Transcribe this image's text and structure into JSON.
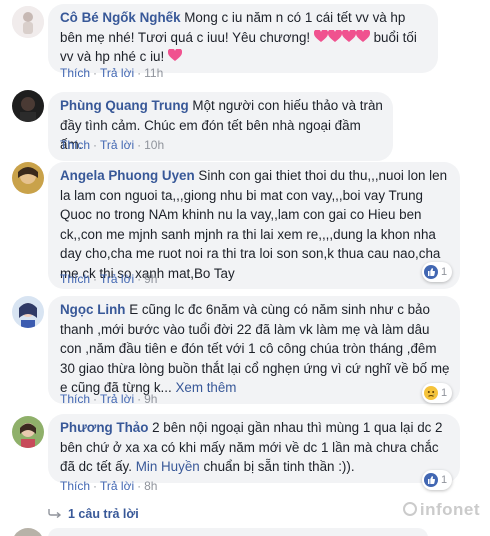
{
  "comments": [
    {
      "author": "Cô Bé Ngốk Nghếk",
      "text_1": "Mong c iu năm n có 1 cái tết vv và hp bên mẹ nhé! Tươi quá c iuu! Yêu chương!",
      "text_2": "buổi tối vv và hp nhé c iu!",
      "like": "Thích",
      "reply": "Trả lời",
      "time": "11h"
    },
    {
      "author": "Phùng Quang Trung",
      "text": "Một người con hiếu thảo và tràn đầy tình cảm. Chúc em đón tết bên nhà ngoại đầm ấm.",
      "like": "Thích",
      "reply": "Trả lời",
      "time": "10h"
    },
    {
      "author": "Angela Phuong Uyen",
      "text": "Sinh con gai thiet thoi du thu,,,nuoi lon len la lam con nguoi ta,,,giong nhu bi mat con vay,,,boi vay Trung Quoc no trong NAm khinh nu la vay,,lam con gai co Hieu ben ck,,con me mjnh sanh mjnh ra thi lai xem re,,,,dung la khon nha day cho,cha me ruot noi ra thi tra loi son son,k thua cau nao,cha me ck thi so xanh mat,Bo Tay",
      "like": "Thích",
      "reply": "Trả lời",
      "time": "9h",
      "reaction_count": "1"
    },
    {
      "author": "Ngọc Linh",
      "text": "E cũng lc đc 6năm và cùng có năm sinh như c bảo thanh ,mới bước vào tuổi đời 22 đã làm vk làm mẹ và làm dâu con ,năm đầu tiên e đón tết với 1 cô công chúa tròn tháng ,đêm 30 giao thừa lòng buồn thắt lại cổ nghẹn ứng vì cứ nghĩ về bố mẹ e cũng đã từng k...",
      "see_more": "Xem thêm",
      "like": "Thích",
      "reply": "Trả lời",
      "time": "9h",
      "reaction_count": "1"
    },
    {
      "author": "Phương Thảo",
      "text": "2 bên nội ngoại gần nhau thì mùng 1 qua lại dc 2 bên chứ ở xa xa có khi mấy năm mới về dc 1 lần mà chưa chắc đã dc tết ấy.",
      "mention": "Min Huyền",
      "text_after": "chuẩn bị sẵn tinh thần :)).",
      "like": "Thích",
      "reply": "Trả lời",
      "time": "8h",
      "reaction_count": "1"
    }
  ],
  "replies_link": "1 câu trả lời",
  "watermark": "infonet",
  "colors": {
    "link": "#385898",
    "action": "#4267b2",
    "bubble": "#f2f3f5",
    "like_blue": "#4267b2",
    "heart_pink": "#f0528f"
  }
}
